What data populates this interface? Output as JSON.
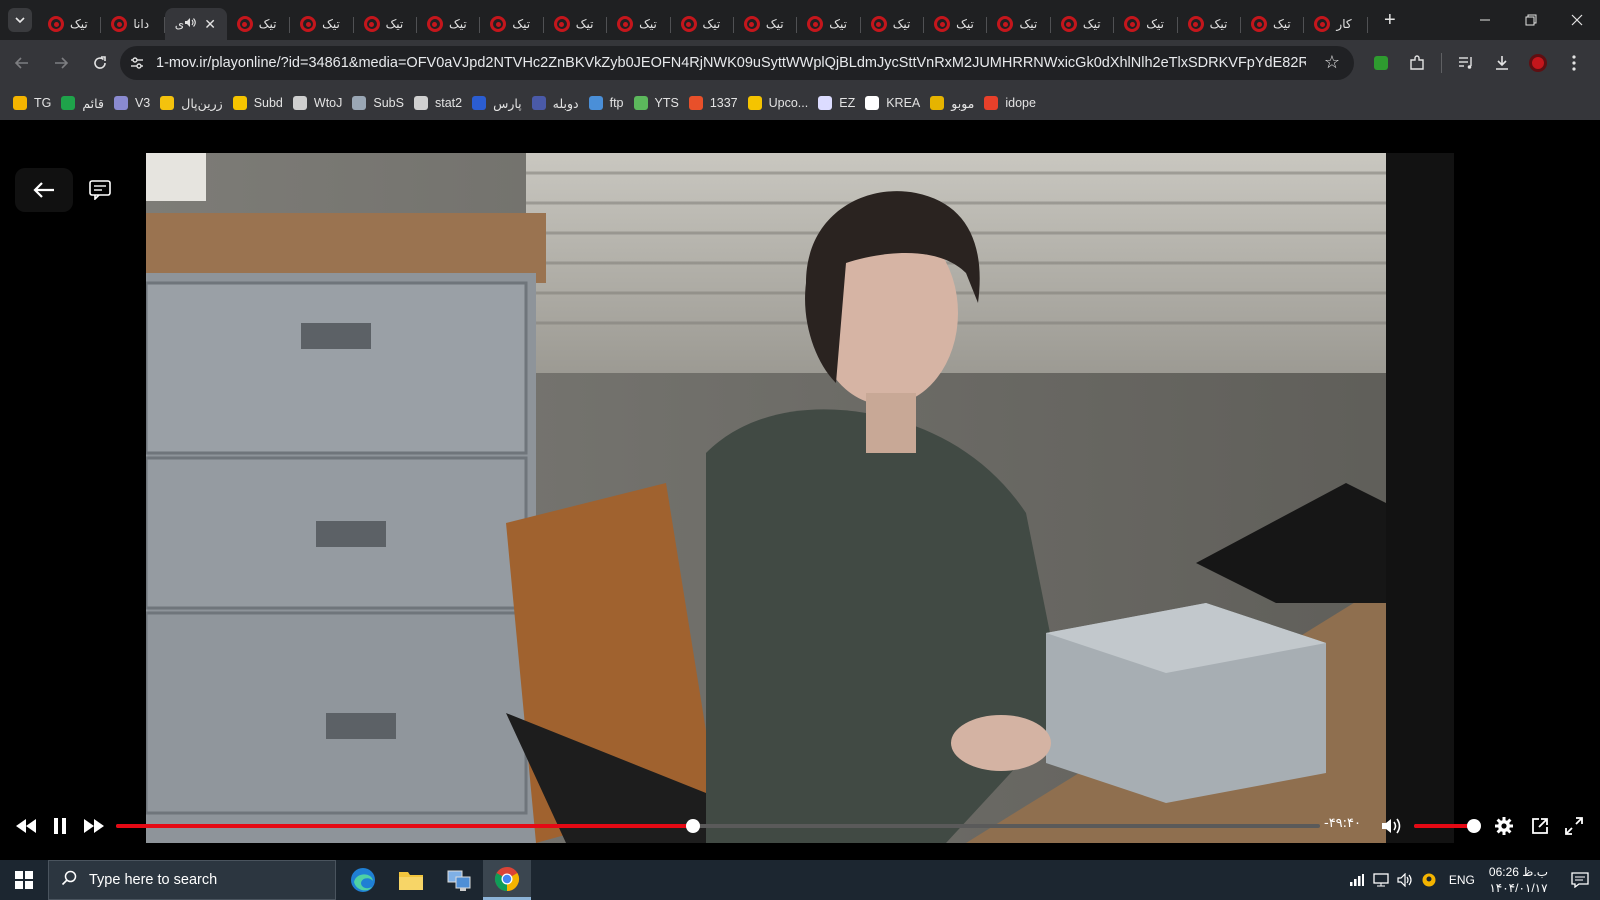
{
  "browser": {
    "tabs": [
      {
        "title": "تیک",
        "active": false
      },
      {
        "title": "دانا",
        "active": false
      },
      {
        "title": "ی",
        "active": true,
        "audio": true
      },
      {
        "title": "تیک",
        "active": false
      },
      {
        "title": "تیک",
        "active": false
      },
      {
        "title": "تیک",
        "active": false
      },
      {
        "title": "تیک",
        "active": false
      },
      {
        "title": "تیک",
        "active": false
      },
      {
        "title": "تیک",
        "active": false
      },
      {
        "title": "تیک",
        "active": false
      },
      {
        "title": "تیک",
        "active": false
      },
      {
        "title": "تیک",
        "active": false
      },
      {
        "title": "تیک",
        "active": false
      },
      {
        "title": "تیک",
        "active": false
      },
      {
        "title": "تیک",
        "active": false
      },
      {
        "title": "تیک",
        "active": false
      },
      {
        "title": "تیک",
        "active": false
      },
      {
        "title": "تیک",
        "active": false
      },
      {
        "title": "تیک",
        "active": false
      },
      {
        "title": "تیک",
        "active": false
      },
      {
        "title": "کار",
        "active": false
      }
    ],
    "new_tab_label": "+",
    "url": "1-mov.ir/playonline/?id=34861&media=OFV0aVJpd2NTVHc2ZnBKVkZyb0JEOFN4RjNWK09uSyttWWplQjBLdmJycSttVnRxM2JUMHRRNWxicGk0dXhlNlh2eTlxSDRKVFpYdE82RzFvOGMyb..."
  },
  "bookmarks": [
    {
      "label": "TG",
      "icon": "tg-icon",
      "color": "#f4b400"
    },
    {
      "label": "قائم",
      "icon": "leaf-icon",
      "color": "#1fa34a"
    },
    {
      "label": "V3",
      "icon": "v3-icon",
      "color": "#8a8ad0"
    },
    {
      "label": "زرین‌پال",
      "icon": "zarinpal-icon",
      "color": "#f4c20d"
    },
    {
      "label": "Subd",
      "icon": "s-icon",
      "color": "#f5c400"
    },
    {
      "label": "WtoJ",
      "icon": "wtoj-icon",
      "color": "#cfcfcf"
    },
    {
      "label": "SubS",
      "icon": "subs-icon",
      "color": "#9aa7b5"
    },
    {
      "label": "stat2",
      "icon": "globe-icon",
      "color": "#d0d0d0"
    },
    {
      "label": "پارس",
      "icon": "pars-icon",
      "color": "#2b5dd1"
    },
    {
      "label": "دوبله",
      "icon": "dub-icon",
      "color": "#4a5aa8"
    },
    {
      "label": "ftp",
      "icon": "ftp-icon",
      "color": "#4a8fd8"
    },
    {
      "label": "YTS",
      "icon": "yts-icon",
      "color": "#5cb85c"
    },
    {
      "label": "1337",
      "icon": "x-icon",
      "color": "#e8502a"
    },
    {
      "label": "Upco...",
      "icon": "upco-icon",
      "color": "#f5c400"
    },
    {
      "label": "EZ",
      "icon": "ez-icon",
      "color": "#dcdcff"
    },
    {
      "label": "KREA",
      "icon": "krea-icon",
      "color": "#ffffff"
    },
    {
      "label": "موبو",
      "icon": "mobo-icon",
      "color": "#e6b400"
    },
    {
      "label": "idope",
      "icon": "idope-icon",
      "color": "#e8402a"
    }
  ],
  "player": {
    "time_remaining": "-۴۹:۴۰",
    "progress": 0.479,
    "volume": 1.0,
    "accent": "#e50914"
  },
  "taskbar": {
    "search_placeholder": "Type here to search",
    "language": "ENG",
    "time": "06:26 ب.ظ",
    "date": "۱۴۰۴/۰۱/۱۷"
  }
}
